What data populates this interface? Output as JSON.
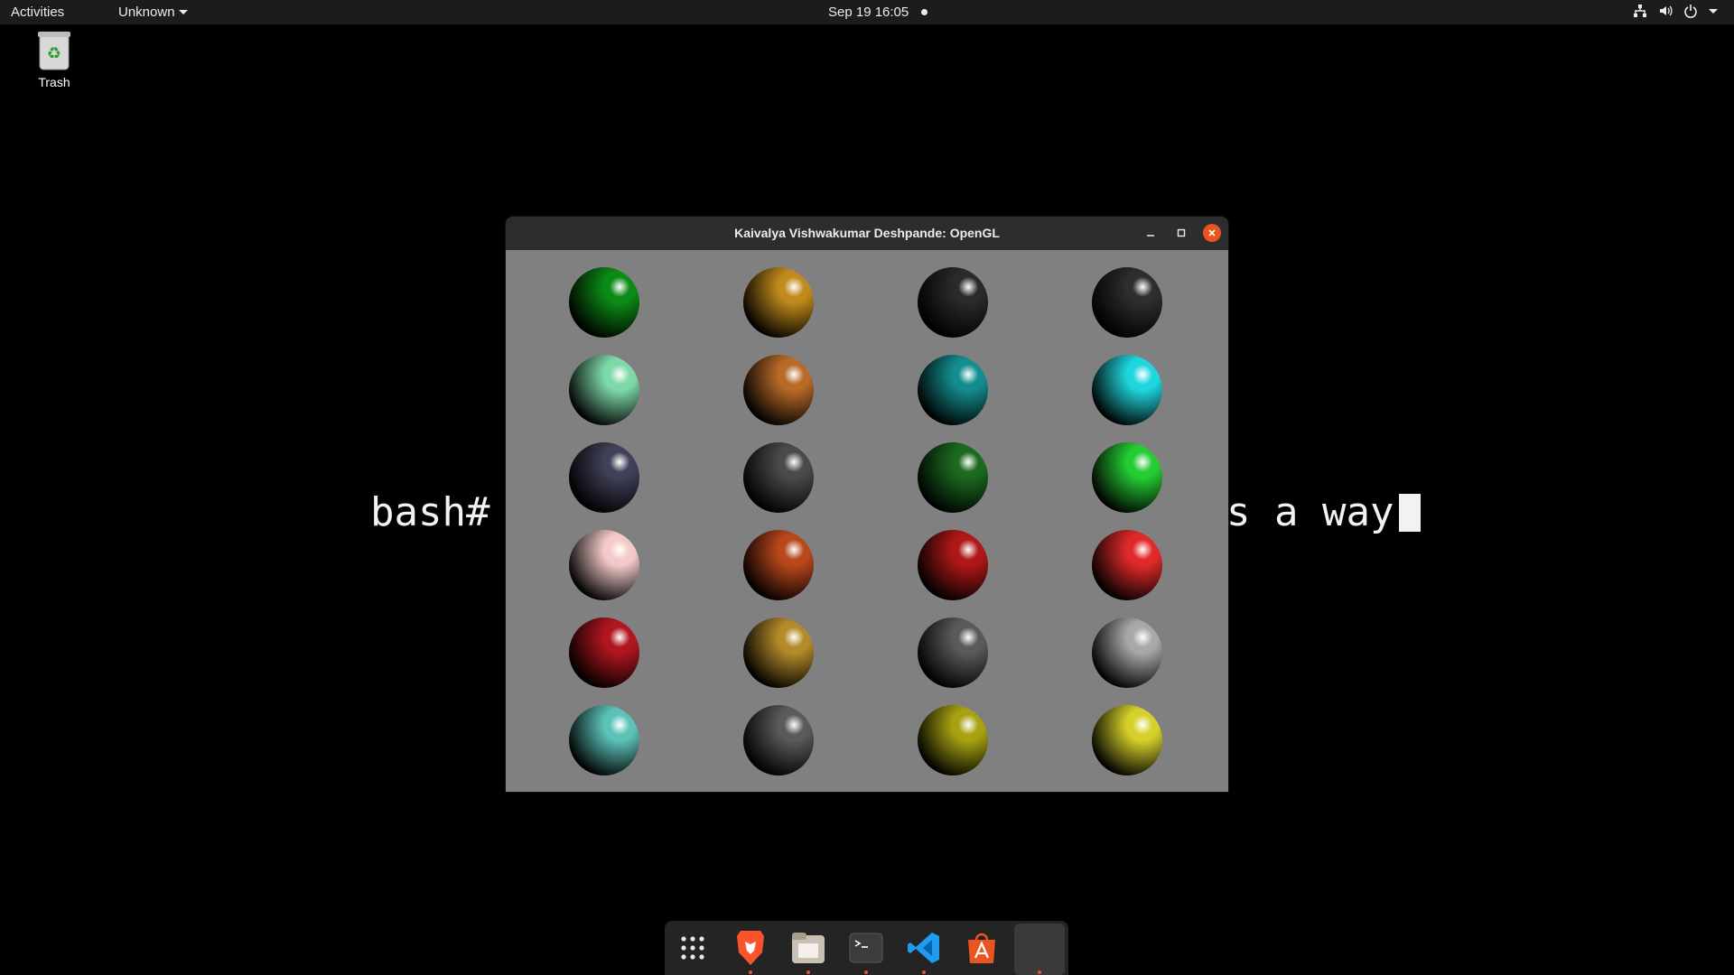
{
  "topbar": {
    "activities": "Activities",
    "app_menu": "Unknown",
    "clock": "Sep 19  16:05",
    "tray_icons": [
      "network-icon",
      "volume-icon",
      "power-icon",
      "chevron-down-icon"
    ]
  },
  "desktop": {
    "trash_label": "Trash"
  },
  "terminal": {
    "prompt": "bash#",
    "visible_tail": "s a way"
  },
  "window": {
    "title": "Kaivalya Vishwakumar Deshpande: OpenGL",
    "background_color": "#808080",
    "sphere_colors": [
      [
        "#0c8a16",
        "#c08a1c",
        "#2a2a2a",
        "#2e2e2e"
      ],
      [
        "#7ed9a8",
        "#b86a28",
        "#138d8f",
        "#20d6de"
      ],
      [
        "#404058",
        "#4a4a4a",
        "#1b6a1e",
        "#25cc33"
      ],
      [
        "#f3c9c9",
        "#b9471b",
        "#b01818",
        "#e02a2a"
      ],
      [
        "#b01620",
        "#b48a2a",
        "#5a5a5a",
        "#a8a8a8"
      ],
      [
        "#5cc2b8",
        "#5a5a5a",
        "#a8a212",
        "#d6d02a"
      ]
    ]
  },
  "dock": {
    "items": [
      {
        "name": "show-apps-icon",
        "running": false
      },
      {
        "name": "brave-browser-icon",
        "running": true
      },
      {
        "name": "files-icon",
        "running": true
      },
      {
        "name": "terminal-icon",
        "running": true
      },
      {
        "name": "vscode-icon",
        "running": true
      },
      {
        "name": "software-center-icon",
        "running": false
      },
      {
        "name": "opengl-app-icon",
        "running": true
      }
    ],
    "accent": "#e95420"
  }
}
